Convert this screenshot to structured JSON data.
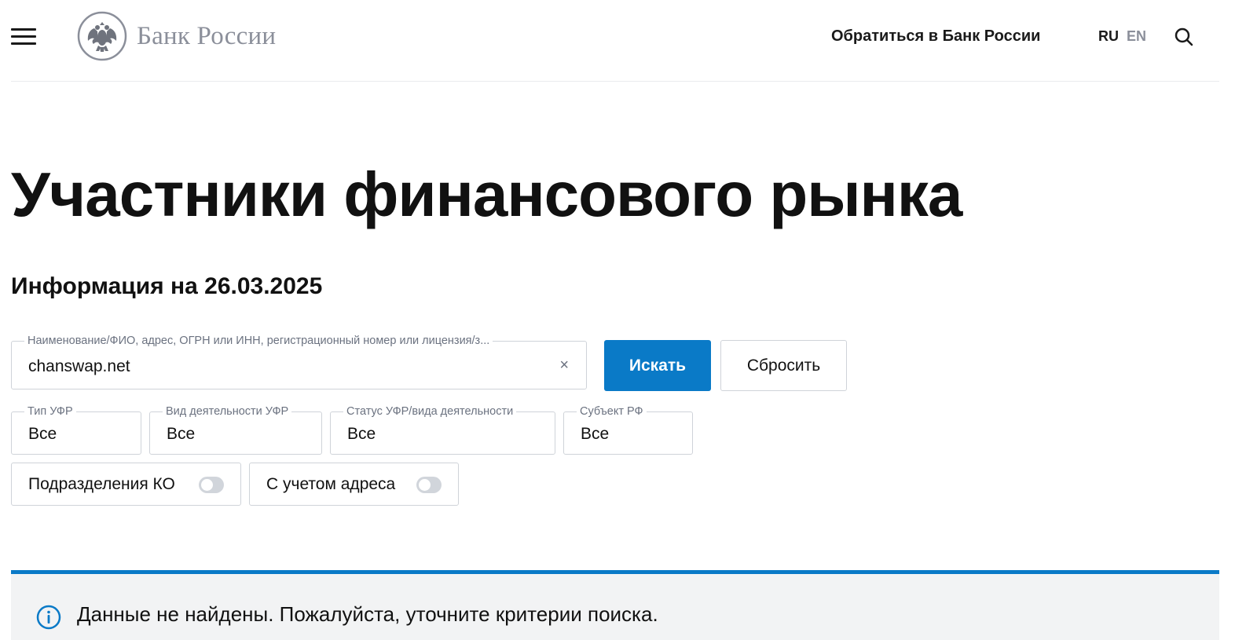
{
  "header": {
    "logo_text": "Банк России",
    "contact_link": "Обратиться в Банк России",
    "lang_ru": "RU",
    "lang_en": "EN"
  },
  "main": {
    "title": "Участники финансового рынка",
    "info_date": "Информация на 26.03.2025"
  },
  "search": {
    "label": "Наименование/ФИО, адрес, ОГРН или ИНН, регистрационный номер или лицензия/з...",
    "value": "chanswap.net",
    "clear_glyph": "×",
    "submit_label": "Искать",
    "reset_label": "Сбросить"
  },
  "filters": {
    "type": {
      "label": "Тип УФР",
      "value": "Все"
    },
    "activity": {
      "label": "Вид деятельности УФР",
      "value": "Все"
    },
    "status": {
      "label": "Статус УФР/вида деятельности",
      "value": "Все"
    },
    "region": {
      "label": "Субъект РФ",
      "value": "Все"
    }
  },
  "toggles": {
    "branches": {
      "label": "Подразделения КО",
      "on": false
    },
    "address": {
      "label": "С учетом адреса",
      "on": false
    }
  },
  "notice": {
    "text": "Данные не найдены. Пожалуйста, уточните критерии поиска."
  },
  "colors": {
    "accent": "#0a7ac7",
    "muted": "#8b8f9a",
    "notice_bg": "#f2f3f4"
  }
}
